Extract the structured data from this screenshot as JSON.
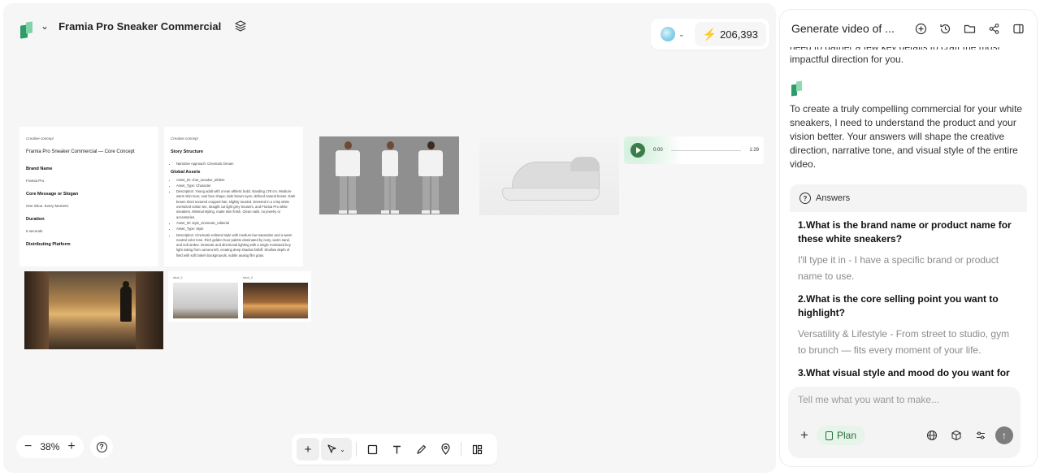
{
  "header": {
    "project_title": "Framia Pro Sneaker Commercial",
    "credits": "206,393"
  },
  "canvas": {
    "doc1": {
      "kicker": "Creative concept",
      "title": "Framia Pro Sneaker Commercial — Core Concept",
      "brand_label": "Brand Name",
      "brand_value": "Framia Pro",
      "core_label": "Core Message or Slogan",
      "core_value": "One Shoe. Every Moment.",
      "duration_label": "Duration",
      "duration_value": "6 seconds",
      "platform_label": "Distributing Platform"
    },
    "doc2": {
      "kicker": "Creative concept",
      "story_label": "Story Structure",
      "narrative": "Narrative Approach: Cinematic Dream",
      "global_label": "Global Assets",
      "items": [
        "Asset_ID: char_sneaker_athlete",
        "Asset_Type: Character",
        "Description: Young adult with a lean athletic build, standing 178 cm. Medium-warm skin tone; oval face shape; dark brown eyes; defined natural brows. Dark brown short textured cropped hair, slightly tousled. Dressed in a crisp white oversized cotton tee, straight cut light grey trousers, and Framia Pro white sneakers. Minimal styling, matte skin finish. Clean nails, no jewelry or accessories.",
        "Asset_ID: style_cinematic_editorial",
        "Asset_Type: Style",
        "Description: Cinematic editorial style with medium-low saturation and a warm neutral color tone. Rich golden hour palette dominated by ivory, warm sand, and soft amber. Dramatic and directional lighting with a single motivated key light raking from camera left, creating deep shadow falloff. Shallow depth of field with soft bokeh backgrounds, subtle analog film grain."
      ]
    },
    "audio": {
      "start": "0:00",
      "end": "1:29"
    },
    "shots": {
      "shot1_label": "shot_1",
      "shot2_label": "shot_2"
    },
    "zoom": "38%"
  },
  "panel": {
    "title": "Generate video of ...",
    "cut_text": "need to gather a few key details to craft the most",
    "intro_tail": "impactful direction for you.",
    "message": "To create a truly compelling commercial for your white sneakers, I need to understand the product and your vision better. Your answers will shape the creative direction, narrative tone, and visual style of the entire video.",
    "answers_label": "Answers",
    "qa": [
      {
        "q": "1.What is the brand name or product name for these white sneakers?",
        "a": "I'll type it in - I have a specific brand or product name to use."
      },
      {
        "q": "2.What is the core selling point you want to highlight?",
        "a": "Versatility & Lifestyle - From street to studio, gym to brunch — fits every moment of your life."
      },
      {
        "q": "3.What visual style and mood do you want for",
        "a": ""
      }
    ],
    "composer_placeholder": "Tell me what you want to make...",
    "plan_label": "Plan"
  }
}
